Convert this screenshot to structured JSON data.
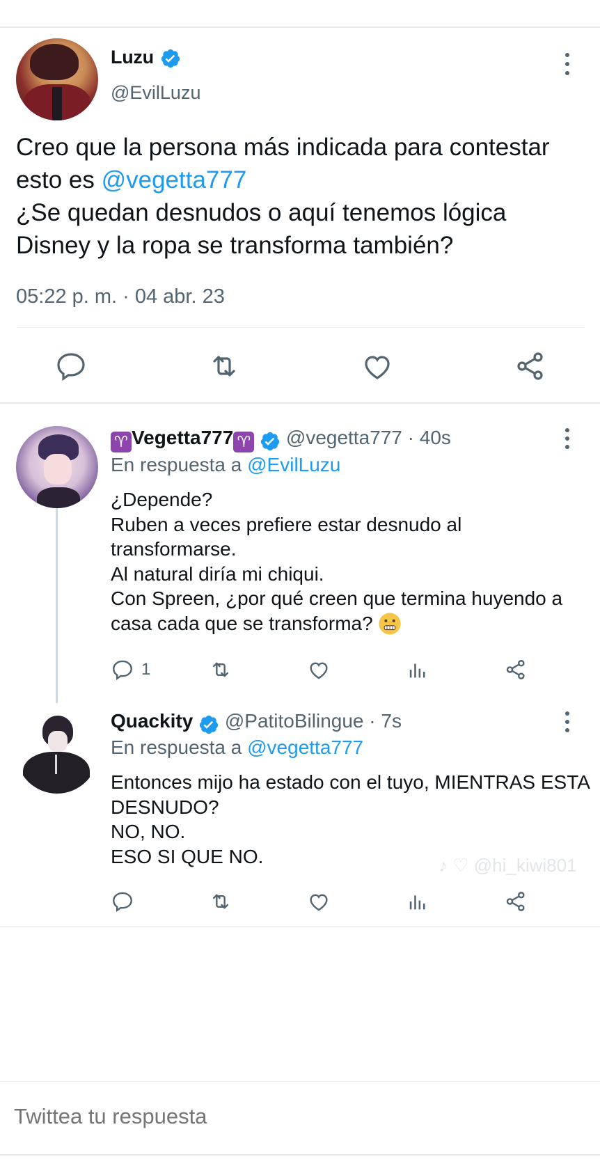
{
  "main_tweet": {
    "name": "Luzu",
    "handle": "@EvilLuzu",
    "text_part1": "Creo que la persona más indicada para contestar esto es ",
    "mention": "@vegetta777",
    "text_part2": "¿Se quedan desnudos o aquí tenemos lógica Disney y la ropa se transforma también?",
    "timestamp": "05:22 p. m. · 04 abr. 23",
    "icons": [
      "reply-icon",
      "retweet-icon",
      "like-icon",
      "share-icon"
    ]
  },
  "replies": [
    {
      "name": "Vegetta777",
      "name_emoji": "♈",
      "handle_time": "@vegetta777 · 40s",
      "replying_prefix": "En respuesta a ",
      "replying_to": "@EvilLuzu",
      "lines": [
        "¿Depende?",
        "Ruben a veces prefiere estar desnudo al transformarse.",
        "Al natural diría mi chiqui.",
        "Con Spreen, ¿por qué creen que termina huyendo a casa cada que se transforma?"
      ],
      "reply_count": "1"
    },
    {
      "name": "Quackity",
      "handle_time": "@PatitoBilingue · 7s",
      "replying_prefix": "En respuesta a ",
      "replying_to": "@vegetta777",
      "lines": [
        "Entonces mijo ha estado con el tuyo, MIENTRAS ESTA DESNUDO?",
        "NO, NO.",
        "ESO SI QUE NO."
      ]
    }
  ],
  "watermark": "♪ ♡ @hi_kiwi801",
  "compose": {
    "placeholder": "Twittea tu respuesta"
  },
  "colors": {
    "accent": "#1d9bf0",
    "secondary_text": "#536471",
    "divider": "#e7e9ea"
  }
}
